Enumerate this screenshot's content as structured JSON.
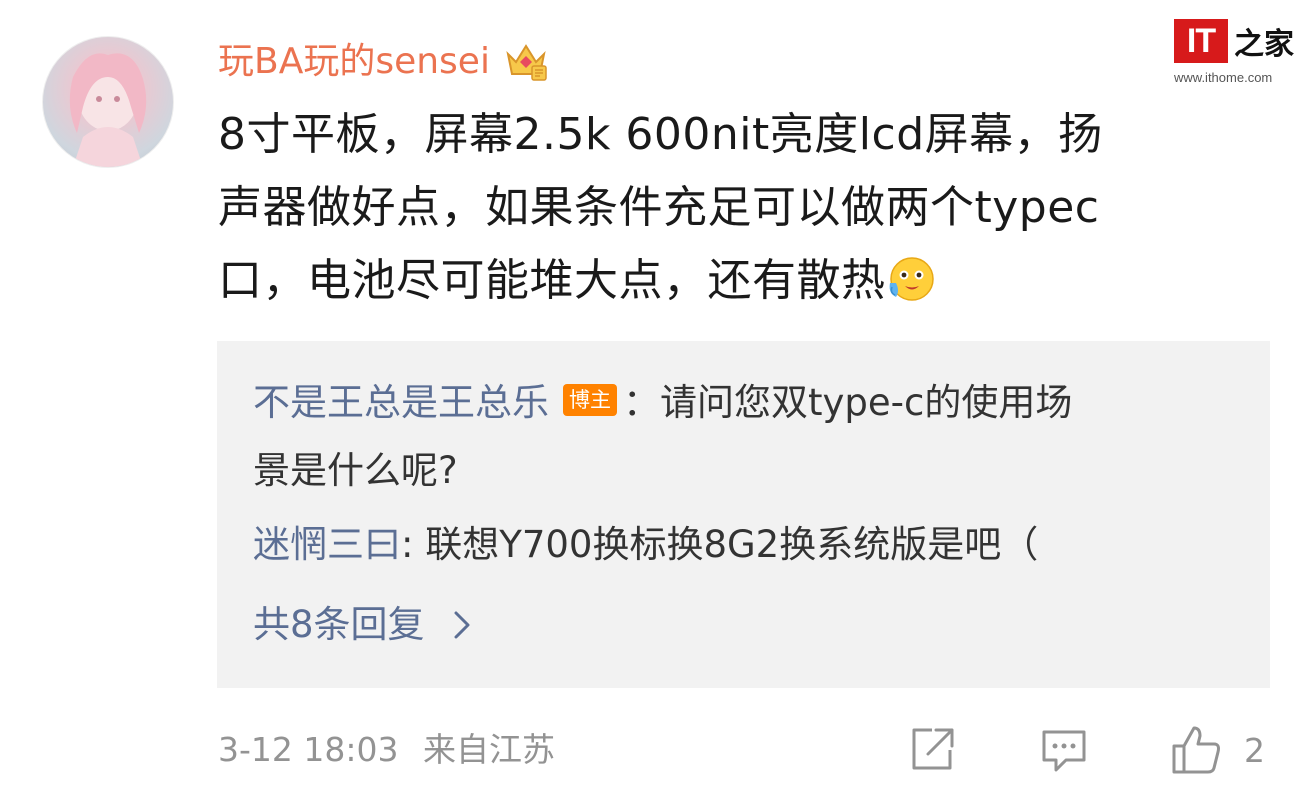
{
  "comment": {
    "username": "玩BA玩的sensei",
    "text_lines": [
      "8寸平板，屏幕2.5k 600nit亮度lcd屏幕，扬",
      "声器做好点，如果条件充足可以做两个typec",
      "口，电池尽可能堆大点，还有散热"
    ],
    "timestamp": "3-12 18:03",
    "location": "来自江苏",
    "likes": "2"
  },
  "replies": [
    {
      "name": "不是王总是王总乐",
      "badge": "博主",
      "text_line1": "：请问您双type-c的使用场",
      "text_line2": "景是什么呢?"
    },
    {
      "name": "迷惘三曰",
      "text": ": 联想Y700换标换8G2换系统版是吧（"
    }
  ],
  "more_replies_label": "共8条回复",
  "watermark": {
    "logo": "IT",
    "cn": "之家",
    "url": "www.ithome.com"
  },
  "colors": {
    "username": "#eb7350",
    "reply_name": "#5b6e94",
    "badge": "#ff8200",
    "meta": "#939393",
    "reply_bg": "#f2f2f2"
  },
  "icons": [
    "avatar",
    "vip-crown-icon",
    "crying-emoji-icon",
    "chevron-right-icon",
    "share-icon",
    "comment-icon",
    "like-icon"
  ]
}
